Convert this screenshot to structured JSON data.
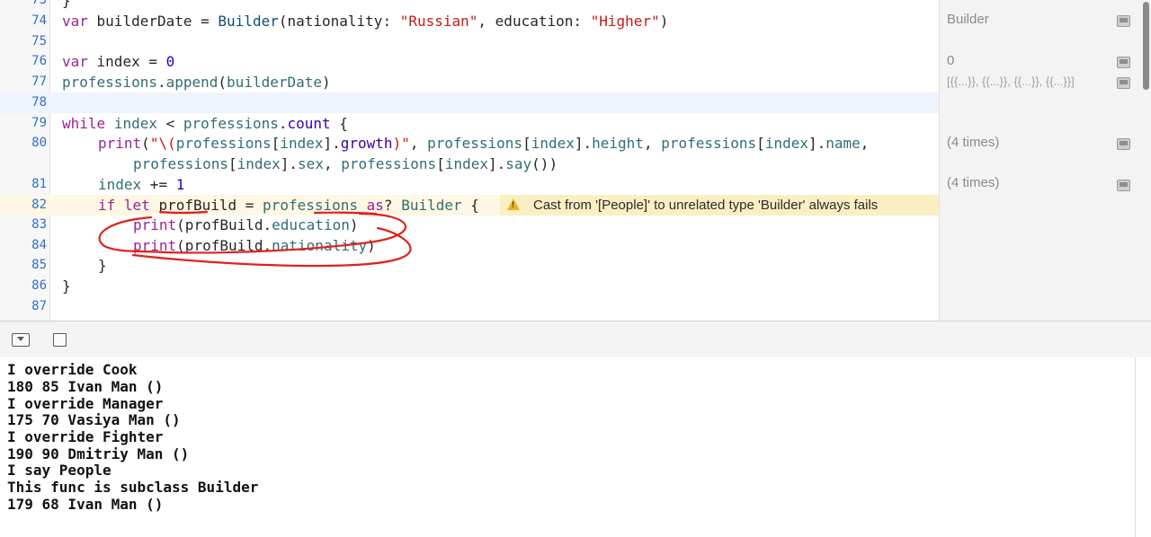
{
  "editor": {
    "lines": [
      {
        "num": "73",
        "tokens": [
          {
            "t": "}",
            "c": "plain"
          }
        ]
      },
      {
        "num": "74",
        "tokens": [
          {
            "t": "var",
            "c": "kw"
          },
          {
            "t": " builderDate = ",
            "c": "plain"
          },
          {
            "t": "Builder",
            "c": "typ"
          },
          {
            "t": "(nationality: ",
            "c": "plain"
          },
          {
            "t": "\"Russian\"",
            "c": "str"
          },
          {
            "t": ", education: ",
            "c": "plain"
          },
          {
            "t": "\"Higher\"",
            "c": "str"
          },
          {
            "t": ")",
            "c": "plain"
          }
        ]
      },
      {
        "num": "75",
        "tokens": []
      },
      {
        "num": "76",
        "tokens": [
          {
            "t": "var",
            "c": "kw"
          },
          {
            "t": " index = ",
            "c": "plain"
          },
          {
            "t": "0",
            "c": "num"
          }
        ]
      },
      {
        "num": "77",
        "tokens": [
          {
            "t": "professions",
            "c": "fn"
          },
          {
            "t": ".",
            "c": "plain"
          },
          {
            "t": "append",
            "c": "fn"
          },
          {
            "t": "(",
            "c": "plain"
          },
          {
            "t": "builderDate",
            "c": "fn"
          },
          {
            "t": ")",
            "c": "plain"
          }
        ]
      },
      {
        "num": "78",
        "tokens": []
      },
      {
        "num": "79",
        "tokens": [
          {
            "t": "while",
            "c": "kw"
          },
          {
            "t": " ",
            "c": "plain"
          },
          {
            "t": "index",
            "c": "fn"
          },
          {
            "t": " < ",
            "c": "plain"
          },
          {
            "t": "professions",
            "c": "fn"
          },
          {
            "t": ".",
            "c": "plain"
          },
          {
            "t": "count",
            "c": "prop"
          },
          {
            "t": " {",
            "c": "plain"
          }
        ]
      },
      {
        "num": "80",
        "tokens": [
          {
            "t": "print",
            "c": "kw"
          },
          {
            "t": "(",
            "c": "plain"
          },
          {
            "t": "\"\\(",
            "c": "str"
          },
          {
            "t": "professions",
            "c": "fn"
          },
          {
            "t": "[",
            "c": "plain"
          },
          {
            "t": "index",
            "c": "fn"
          },
          {
            "t": "].",
            "c": "plain"
          },
          {
            "t": "growth",
            "c": "prop"
          },
          {
            "t": ")\"",
            "c": "str"
          },
          {
            "t": ", ",
            "c": "plain"
          },
          {
            "t": "professions",
            "c": "fn"
          },
          {
            "t": "[",
            "c": "plain"
          },
          {
            "t": "index",
            "c": "fn"
          },
          {
            "t": "].",
            "c": "plain"
          },
          {
            "t": "height",
            "c": "fn"
          },
          {
            "t": ", ",
            "c": "plain"
          },
          {
            "t": "professions",
            "c": "fn"
          },
          {
            "t": "[",
            "c": "plain"
          },
          {
            "t": "index",
            "c": "fn"
          },
          {
            "t": "].",
            "c": "plain"
          },
          {
            "t": "name",
            "c": "fn"
          },
          {
            "t": ",",
            "c": "plain"
          }
        ]
      },
      {
        "num": "",
        "tokens": [
          {
            "t": "professions",
            "c": "fn"
          },
          {
            "t": "[",
            "c": "plain"
          },
          {
            "t": "index",
            "c": "fn"
          },
          {
            "t": "].",
            "c": "plain"
          },
          {
            "t": "sex",
            "c": "fn"
          },
          {
            "t": ", ",
            "c": "plain"
          },
          {
            "t": "professions",
            "c": "fn"
          },
          {
            "t": "[",
            "c": "plain"
          },
          {
            "t": "index",
            "c": "fn"
          },
          {
            "t": "].",
            "c": "plain"
          },
          {
            "t": "say",
            "c": "fn"
          },
          {
            "t": "())",
            "c": "plain"
          }
        ]
      },
      {
        "num": "81",
        "tokens": [
          {
            "t": "index",
            "c": "fn"
          },
          {
            "t": " += ",
            "c": "plain"
          },
          {
            "t": "1",
            "c": "num"
          }
        ]
      },
      {
        "num": "82",
        "tokens": [
          {
            "t": "if",
            "c": "kw"
          },
          {
            "t": " ",
            "c": "plain"
          },
          {
            "t": "let",
            "c": "kw"
          },
          {
            "t": " profBuild = ",
            "c": "plain"
          },
          {
            "t": "professions",
            "c": "fn"
          },
          {
            "t": " ",
            "c": "plain"
          },
          {
            "t": "as",
            "c": "kw"
          },
          {
            "t": "? ",
            "c": "plain"
          },
          {
            "t": "Builder",
            "c": "fn"
          },
          {
            "t": " {",
            "c": "plain"
          }
        ]
      },
      {
        "num": "83",
        "tokens": [
          {
            "t": "print",
            "c": "kw"
          },
          {
            "t": "(profBuild.",
            "c": "plain"
          },
          {
            "t": "education",
            "c": "fn"
          },
          {
            "t": ")",
            "c": "plain"
          }
        ]
      },
      {
        "num": "84",
        "tokens": [
          {
            "t": "print",
            "c": "kw"
          },
          {
            "t": "(profBuild.",
            "c": "plain"
          },
          {
            "t": "nationality",
            "c": "fn"
          },
          {
            "t": ")",
            "c": "plain"
          }
        ]
      },
      {
        "num": "85",
        "tokens": [
          {
            "t": "}",
            "c": "plain"
          }
        ]
      },
      {
        "num": "86",
        "tokens": [
          {
            "t": "}",
            "c": "plain"
          }
        ]
      },
      {
        "num": "87",
        "tokens": []
      }
    ],
    "warning_text": "Cast from '[People]' to unrelated type 'Builder' always fails"
  },
  "results": {
    "builder": "Builder",
    "zero": "0",
    "array": "[{{...}}, {{...}}, {{...}}, {{...}}]",
    "times80": "(4 times)",
    "times81": "(4 times)"
  },
  "colors": {
    "warning_bg": "#faeec3",
    "current_line": "#eef3fc",
    "annotation": "#e0201b"
  },
  "console": {
    "lines": [
      "I override Cook",
      "180 85 Ivan Man ()",
      "I override Manager",
      "175 70 Vasiya Man ()",
      "I override Fighter",
      "190 90 Dmitriy Man ()",
      "I say People",
      "This func is subclass Builder",
      "179 68 Ivan Man ()"
    ]
  }
}
